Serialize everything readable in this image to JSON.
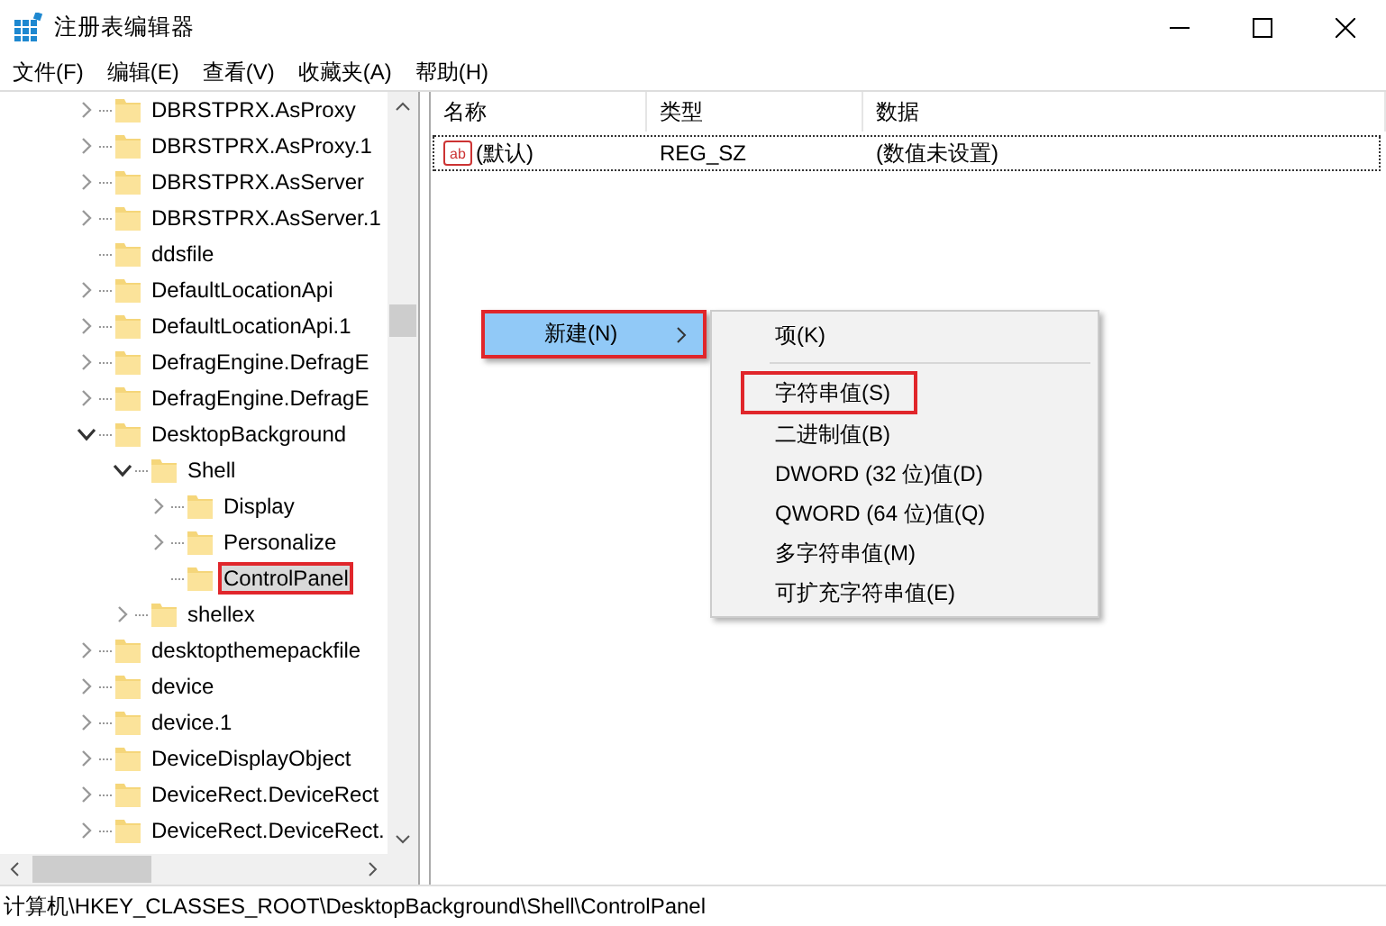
{
  "window": {
    "title": "注册表编辑器"
  },
  "menu": [
    "文件(F)",
    "编辑(E)",
    "查看(V)",
    "收藏夹(A)",
    "帮助(H)"
  ],
  "tree": [
    {
      "label": "DBRSTPRX.AsProxy",
      "leaf": false,
      "expanded": false,
      "selected": false,
      "annotated": false
    },
    {
      "label": "DBRSTPRX.AsProxy.1",
      "leaf": false,
      "expanded": false,
      "selected": false,
      "annotated": false
    },
    {
      "label": "DBRSTPRX.AsServer",
      "leaf": false,
      "expanded": false,
      "selected": false,
      "annotated": false
    },
    {
      "label": "DBRSTPRX.AsServer.1",
      "leaf": false,
      "expanded": false,
      "selected": false,
      "annotated": false
    },
    {
      "label": "ddsfile",
      "leaf": true,
      "selected": false,
      "annotated": false
    },
    {
      "label": "DefaultLocationApi",
      "leaf": false,
      "expanded": false,
      "selected": false,
      "annotated": false
    },
    {
      "label": "DefaultLocationApi.1",
      "leaf": false,
      "expanded": false,
      "selected": false,
      "annotated": false
    },
    {
      "label": "DefragEngine.DefragE",
      "leaf": false,
      "expanded": false,
      "selected": false,
      "annotated": false
    },
    {
      "label": "DefragEngine.DefragE",
      "leaf": false,
      "expanded": false,
      "selected": false,
      "annotated": false
    },
    {
      "label": "DesktopBackground",
      "leaf": false,
      "expanded": true,
      "selected": false,
      "annotated": false,
      "children": [
        {
          "label": "Shell",
          "leaf": false,
          "expanded": true,
          "selected": false,
          "annotated": false,
          "children": [
            {
              "label": "Display",
              "leaf": false,
              "expanded": false,
              "selected": false,
              "annotated": false
            },
            {
              "label": "Personalize",
              "leaf": false,
              "expanded": false,
              "selected": false,
              "annotated": false
            },
            {
              "label": "ControlPanel",
              "leaf": true,
              "selected": true,
              "annotated": true
            }
          ]
        },
        {
          "label": "shellex",
          "leaf": false,
          "expanded": false,
          "selected": false,
          "annotated": false
        }
      ]
    },
    {
      "label": "desktopthemepackfile",
      "leaf": false,
      "expanded": false,
      "selected": false,
      "annotated": false
    },
    {
      "label": "device",
      "leaf": false,
      "expanded": false,
      "selected": false,
      "annotated": false
    },
    {
      "label": "device.1",
      "leaf": false,
      "expanded": false,
      "selected": false,
      "annotated": false
    },
    {
      "label": "DeviceDisplayObject",
      "leaf": false,
      "expanded": false,
      "selected": false,
      "annotated": false
    },
    {
      "label": "DeviceRect.DeviceRect",
      "leaf": false,
      "expanded": false,
      "selected": false,
      "annotated": false
    },
    {
      "label": "DeviceRect.DeviceRect.",
      "leaf": false,
      "expanded": false,
      "selected": false,
      "annotated": false
    }
  ],
  "values": {
    "columns": [
      "名称",
      "类型",
      "数据"
    ],
    "rows": [
      {
        "icon": "ab",
        "name": "(默认)",
        "type": "REG_SZ",
        "data": "(数值未设置)",
        "focused": true
      }
    ]
  },
  "context_menu": {
    "items": [
      {
        "label": "新建(N)",
        "selected": true,
        "annotated": true
      }
    ]
  },
  "submenu": {
    "items": [
      {
        "kind": "item",
        "label": "项(K)",
        "annotated": false
      },
      {
        "kind": "separator"
      },
      {
        "kind": "item",
        "label": "字符串值(S)",
        "annotated": true
      },
      {
        "kind": "item",
        "label": "二进制值(B)",
        "annotated": false
      },
      {
        "kind": "item",
        "label": "DWORD (32 位)值(D)",
        "annotated": false
      },
      {
        "kind": "item",
        "label": "QWORD (64 位)值(Q)",
        "annotated": false
      },
      {
        "kind": "item",
        "label": "多字符串值(M)",
        "annotated": false
      },
      {
        "kind": "item",
        "label": "可扩充字符串值(E)",
        "annotated": false
      }
    ]
  },
  "status_bar": "计算机\\HKEY_CLASSES_ROOT\\DesktopBackground\\Shell\\ControlPanel"
}
